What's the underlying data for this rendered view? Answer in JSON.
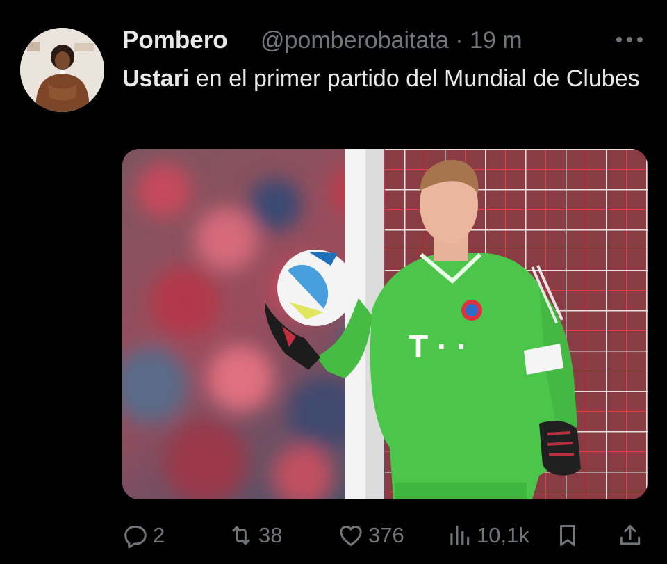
{
  "post": {
    "author_name": "Pombero",
    "handle_and_time": "@pomberobaitata · 19 m",
    "text_bold": "Ustari",
    "text_rest": " en el primer partido del Mundial de Clubes"
  },
  "media": {
    "kit_sponsor": "T · ·"
  },
  "actions": {
    "reply_count": "2",
    "retweet_count": "38",
    "like_count": "376",
    "views_count": "10,1k"
  },
  "colors": {
    "background": "#000000",
    "primary_text": "#e7e9ea",
    "secondary_text": "#71767b",
    "kit_green": "#4cc64a"
  },
  "icons": [
    "more-icon",
    "reply-icon",
    "retweet-icon",
    "like-icon",
    "views-icon",
    "bookmark-icon",
    "share-icon"
  ]
}
